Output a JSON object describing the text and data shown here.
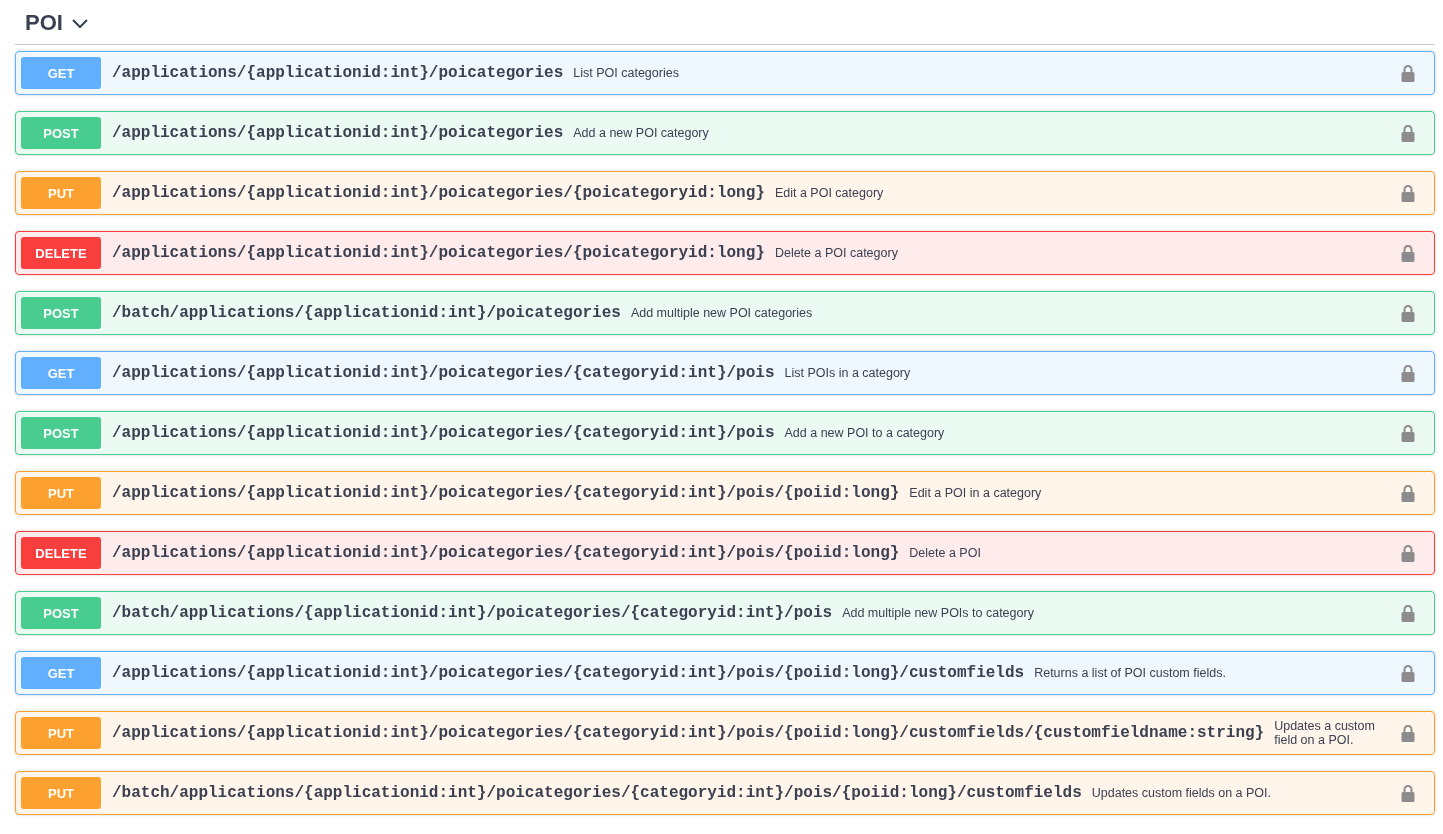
{
  "section": {
    "title": "POI",
    "expanded": true
  },
  "operations": [
    {
      "kind": "get",
      "method": "GET",
      "path": "/applications/{applicationid:int}/poicategories",
      "description": "List POI categories"
    },
    {
      "kind": "post",
      "method": "POST",
      "path": "/applications/{applicationid:int}/poicategories",
      "description": "Add a new POI category"
    },
    {
      "kind": "put",
      "method": "PUT",
      "path": "/applications/{applicationid:int}/poicategories/{poicategoryid:long}",
      "description": "Edit a POI category"
    },
    {
      "kind": "delete",
      "method": "DELETE",
      "path": "/applications/{applicationid:int}/poicategories/{poicategoryid:long}",
      "description": "Delete a POI category"
    },
    {
      "kind": "post",
      "method": "POST",
      "path": "/batch/applications/{applicationid:int}/poicategories",
      "description": "Add multiple new POI categories"
    },
    {
      "kind": "get",
      "method": "GET",
      "path": "/applications/{applicationid:int}/poicategories/{categoryid:int}/pois",
      "description": "List POIs in a category"
    },
    {
      "kind": "post",
      "method": "POST",
      "path": "/applications/{applicationid:int}/poicategories/{categoryid:int}/pois",
      "description": "Add a new POI to a category"
    },
    {
      "kind": "put",
      "method": "PUT",
      "path": "/applications/{applicationid:int}/poicategories/{categoryid:int}/pois/{poiid:long}",
      "description": "Edit a POI in a category"
    },
    {
      "kind": "delete",
      "method": "DELETE",
      "path": "/applications/{applicationid:int}/poicategories/{categoryid:int}/pois/{poiid:long}",
      "description": "Delete a POI"
    },
    {
      "kind": "post",
      "method": "POST",
      "path": "/batch/applications/{applicationid:int}/poicategories/{categoryid:int}/pois",
      "description": "Add multiple new POIs to category"
    },
    {
      "kind": "get",
      "method": "GET",
      "path": "/applications/{applicationid:int}/poicategories/{categoryid:int}/pois/{poiid:long}/customfields",
      "description": "Returns a list of POI custom fields."
    },
    {
      "kind": "put",
      "method": "PUT",
      "path": "/applications/{applicationid:int}/poicategories/{categoryid:int}/pois/{poiid:long}/customfields/{customfieldname:string}",
      "description": "Updates a custom field on a POI."
    },
    {
      "kind": "put",
      "method": "PUT",
      "path": "/batch/applications/{applicationid:int}/poicategories/{categoryid:int}/pois/{poiid:long}/customfields",
      "description": "Updates custom fields on a POI."
    }
  ]
}
